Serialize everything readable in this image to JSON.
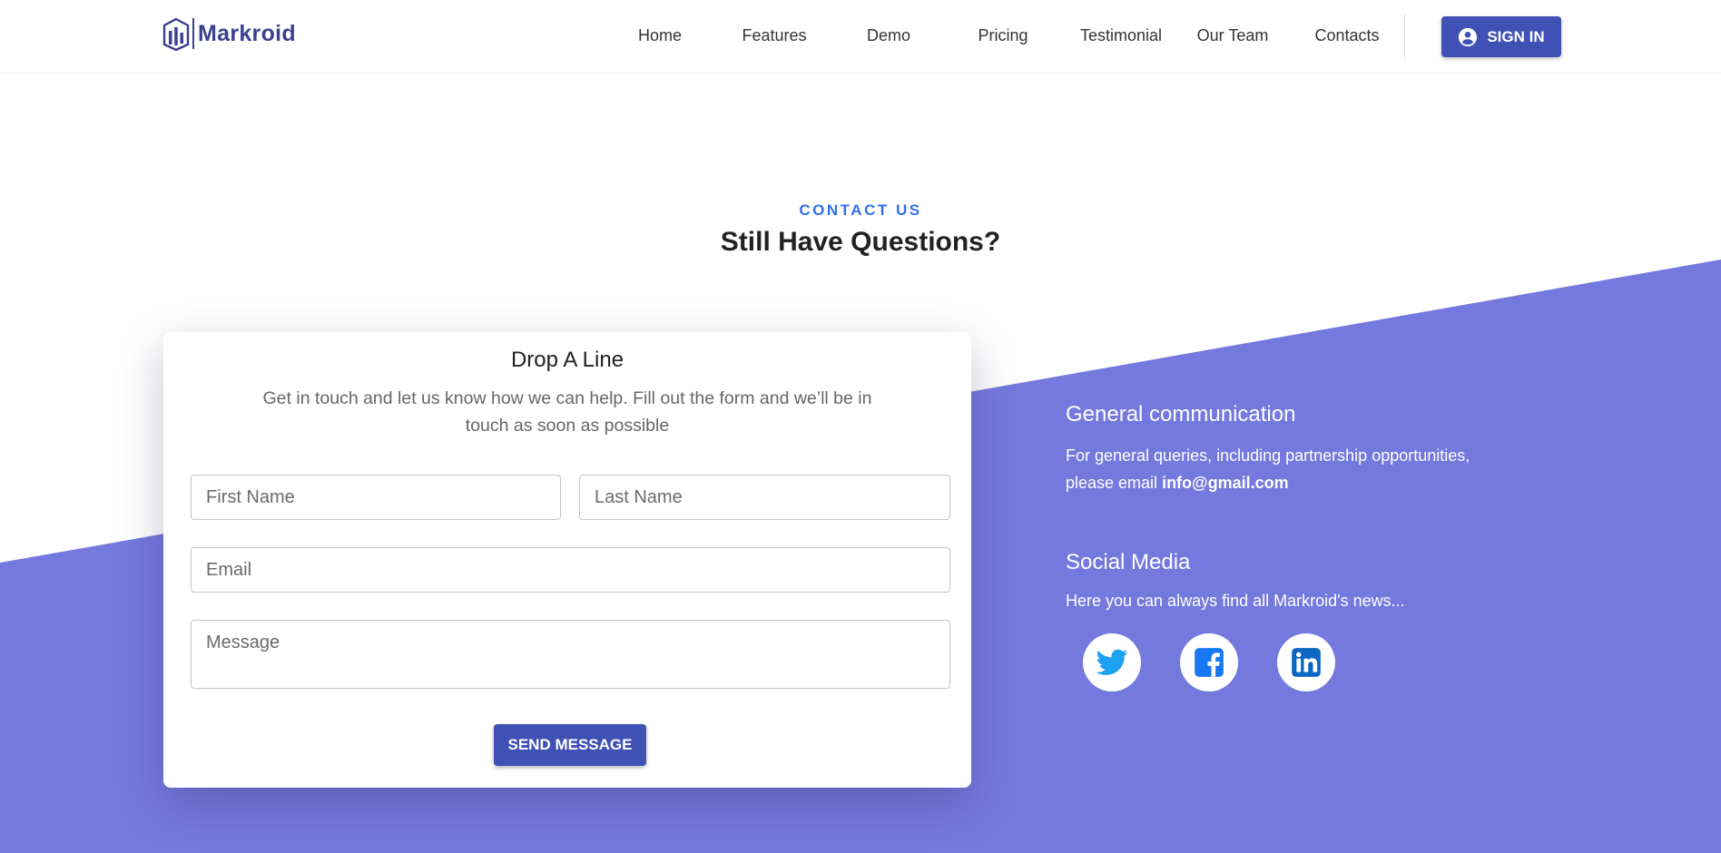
{
  "brand": {
    "name": "Markroid",
    "color": "#3a3f8f"
  },
  "nav": {
    "items": [
      {
        "label": "Home"
      },
      {
        "label": "Features"
      },
      {
        "label": "Demo"
      },
      {
        "label": "Pricing"
      },
      {
        "label": "Testimonial"
      },
      {
        "label": "Our Team"
      },
      {
        "label": "Contacts"
      }
    ],
    "signin_label": "SIGN IN",
    "signin_icon": "account-circle-icon"
  },
  "section": {
    "eyebrow": "CONTACT US",
    "title": "Still Have Questions?"
  },
  "form": {
    "title": "Drop A Line",
    "description": "Get in touch and let us know how we can help. Fill out the form and we’ll be in touch as soon as possible",
    "first_name": {
      "placeholder": "First Name",
      "value": ""
    },
    "last_name": {
      "placeholder": "Last Name",
      "value": ""
    },
    "email": {
      "placeholder": "Email",
      "value": ""
    },
    "message": {
      "placeholder": "Message",
      "value": ""
    },
    "submit_label": "SEND MESSAGE"
  },
  "info": {
    "general_title": "General communication",
    "general_text": "For general queries, including partnership opportunities, please email ",
    "general_email": "info@gmail.com",
    "social_title": "Social Media",
    "social_text": "Here you can always find all Markroid's news...",
    "social_icons": [
      "twitter-icon",
      "facebook-icon",
      "linkedin-icon"
    ]
  },
  "colors": {
    "accent": "#3f51b5",
    "eyebrow": "#2f6fed",
    "diagonal_bg": "#7479dd",
    "twitter": "#1da1f2",
    "facebook": "#1877f2",
    "linkedin": "#0a66c2"
  }
}
